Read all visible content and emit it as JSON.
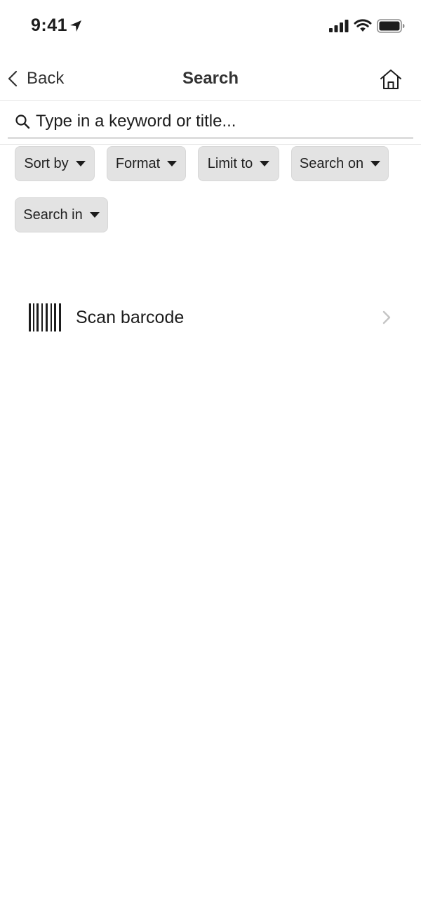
{
  "status_bar": {
    "time": "9:41"
  },
  "nav": {
    "back_label": "Back",
    "title": "Search"
  },
  "search": {
    "placeholder": "Type in a keyword or title..."
  },
  "filters": {
    "sort_by": "Sort by",
    "format": "Format",
    "limit_to": "Limit to",
    "search_on": "Search on",
    "search_in": "Search in"
  },
  "scan": {
    "label": "Scan barcode"
  },
  "icons": {
    "location": "location-arrow-icon",
    "signal": "cellular-signal-icon",
    "wifi": "wifi-icon",
    "battery": "battery-icon",
    "back": "chevron-left-icon",
    "home": "home-icon",
    "search": "search-icon",
    "caret": "caret-down-icon",
    "barcode": "barcode-icon",
    "chevron": "chevron-right-icon"
  },
  "colors": {
    "text": "#1c1c1c",
    "chip_background": "#e3e3e3",
    "chevron": "#c4c4c4",
    "divider": "#e6e6e6"
  }
}
